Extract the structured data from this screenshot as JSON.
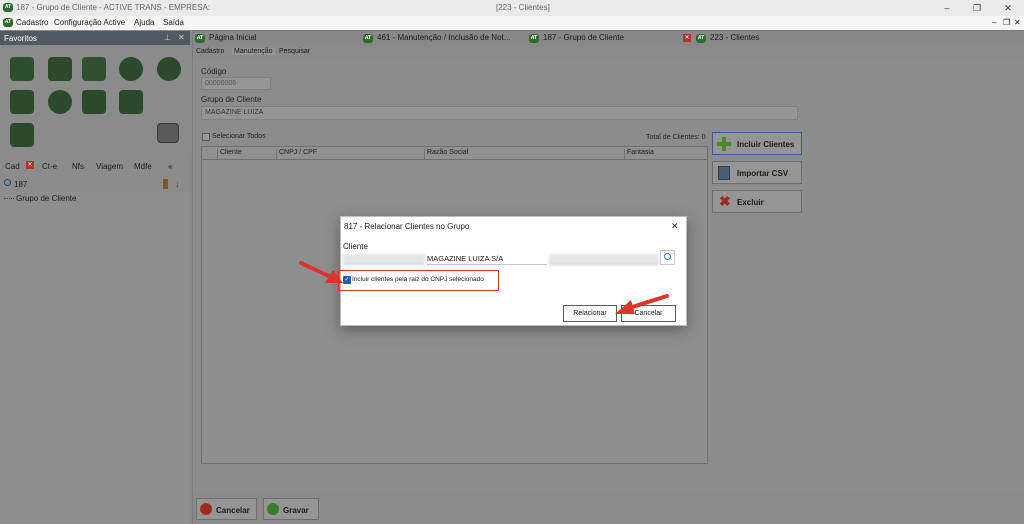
{
  "titlebar": {
    "title": "187 - Grupo de Cliente - ACTIVE TRANS - EMPRESA:",
    "title_right": "[223 - Clientes]",
    "minimize": "–",
    "restore": "❐",
    "close": "✕"
  },
  "menubar": {
    "items": [
      "Cadastro",
      "Configuração Active",
      "Ajuda",
      "Saída"
    ],
    "mdi_min": "–",
    "mdi_restore": "❐",
    "mdi_close": "✕"
  },
  "logo_text": "AT",
  "favoritos": {
    "title": "Favoritos",
    "pin": "⊥",
    "close": "✕"
  },
  "leftnav": {
    "items": [
      "Cad",
      "Ct-e",
      "Nfs",
      "Viagem",
      "Mdfe"
    ],
    "close_badge": "✕",
    "collapse": "«"
  },
  "left_search": {
    "value": "187"
  },
  "tree": {
    "items": [
      "Grupo de Cliente"
    ]
  },
  "tabs": [
    {
      "label": "Página Inicial"
    },
    {
      "label": "461 - Manutenção / Inclusão de Not..."
    },
    {
      "label": "187 - Grupo de Cliente"
    },
    {
      "label": "223 - Clientes"
    }
  ],
  "subtabs": [
    "Cadastro",
    "Manutenção",
    "Pesquisar"
  ],
  "form": {
    "codigo_label": "Código",
    "codigo_value": "00000006",
    "grupo_label": "Grupo de Cliente",
    "grupo_value": "MAGAZINE LUIZA",
    "selecionar_todos": "Selecionar Todos",
    "total_clientes": "Total de Clientes: 0"
  },
  "grid": {
    "columns": [
      "Cliente",
      "CNPJ / CPF",
      "Razão Social",
      "Fantasia"
    ]
  },
  "side_buttons": {
    "incluir": "Incluir Clientes",
    "importar": "Importar CSV",
    "excluir": "Excluir"
  },
  "bottom_buttons": {
    "cancelar": "Cancelar",
    "gravar": "Gravar"
  },
  "dialog": {
    "title": "817 - Relacionar Clientes no Grupo",
    "close": "✕",
    "cliente_label": "Cliente",
    "razao_social": "MAGAZINE LUIZA S/A",
    "checkbox_label": "Incluir clientes pela raiz do CNPJ selecionado",
    "checkbox_checked": true,
    "relacionar": "Relacionar",
    "cancelar": "Cancelar"
  },
  "colors": {
    "accent_red": "#d9352b",
    "checkbox_blue": "#1a5fb4",
    "logo_green": "#2f6b2f"
  }
}
